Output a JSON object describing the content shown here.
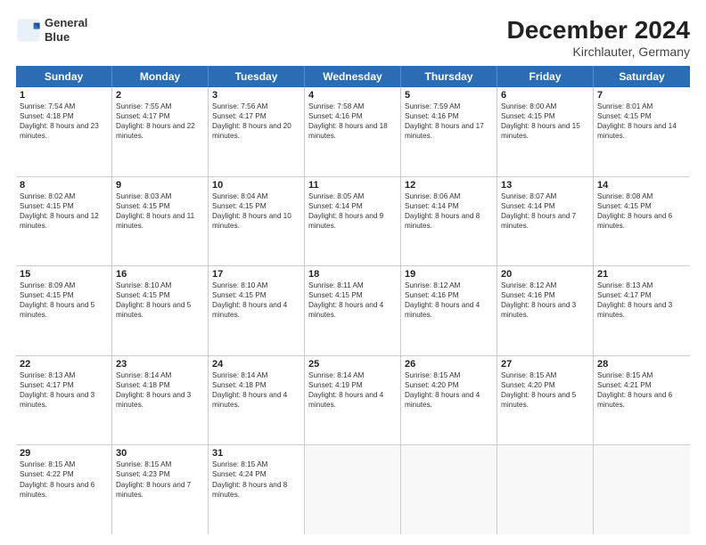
{
  "header": {
    "logo_line1": "General",
    "logo_line2": "Blue",
    "title": "December 2024",
    "subtitle": "Kirchlauter, Germany"
  },
  "days_of_week": [
    "Sunday",
    "Monday",
    "Tuesday",
    "Wednesday",
    "Thursday",
    "Friday",
    "Saturday"
  ],
  "weeks": [
    [
      {
        "day": "1",
        "sunrise": "Sunrise: 7:54 AM",
        "sunset": "Sunset: 4:18 PM",
        "daylight": "Daylight: 8 hours and 23 minutes."
      },
      {
        "day": "2",
        "sunrise": "Sunrise: 7:55 AM",
        "sunset": "Sunset: 4:17 PM",
        "daylight": "Daylight: 8 hours and 22 minutes."
      },
      {
        "day": "3",
        "sunrise": "Sunrise: 7:56 AM",
        "sunset": "Sunset: 4:17 PM",
        "daylight": "Daylight: 8 hours and 20 minutes."
      },
      {
        "day": "4",
        "sunrise": "Sunrise: 7:58 AM",
        "sunset": "Sunset: 4:16 PM",
        "daylight": "Daylight: 8 hours and 18 minutes."
      },
      {
        "day": "5",
        "sunrise": "Sunrise: 7:59 AM",
        "sunset": "Sunset: 4:16 PM",
        "daylight": "Daylight: 8 hours and 17 minutes."
      },
      {
        "day": "6",
        "sunrise": "Sunrise: 8:00 AM",
        "sunset": "Sunset: 4:15 PM",
        "daylight": "Daylight: 8 hours and 15 minutes."
      },
      {
        "day": "7",
        "sunrise": "Sunrise: 8:01 AM",
        "sunset": "Sunset: 4:15 PM",
        "daylight": "Daylight: 8 hours and 14 minutes."
      }
    ],
    [
      {
        "day": "8",
        "sunrise": "Sunrise: 8:02 AM",
        "sunset": "Sunset: 4:15 PM",
        "daylight": "Daylight: 8 hours and 12 minutes."
      },
      {
        "day": "9",
        "sunrise": "Sunrise: 8:03 AM",
        "sunset": "Sunset: 4:15 PM",
        "daylight": "Daylight: 8 hours and 11 minutes."
      },
      {
        "day": "10",
        "sunrise": "Sunrise: 8:04 AM",
        "sunset": "Sunset: 4:15 PM",
        "daylight": "Daylight: 8 hours and 10 minutes."
      },
      {
        "day": "11",
        "sunrise": "Sunrise: 8:05 AM",
        "sunset": "Sunset: 4:14 PM",
        "daylight": "Daylight: 8 hours and 9 minutes."
      },
      {
        "day": "12",
        "sunrise": "Sunrise: 8:06 AM",
        "sunset": "Sunset: 4:14 PM",
        "daylight": "Daylight: 8 hours and 8 minutes."
      },
      {
        "day": "13",
        "sunrise": "Sunrise: 8:07 AM",
        "sunset": "Sunset: 4:14 PM",
        "daylight": "Daylight: 8 hours and 7 minutes."
      },
      {
        "day": "14",
        "sunrise": "Sunrise: 8:08 AM",
        "sunset": "Sunset: 4:15 PM",
        "daylight": "Daylight: 8 hours and 6 minutes."
      }
    ],
    [
      {
        "day": "15",
        "sunrise": "Sunrise: 8:09 AM",
        "sunset": "Sunset: 4:15 PM",
        "daylight": "Daylight: 8 hours and 5 minutes."
      },
      {
        "day": "16",
        "sunrise": "Sunrise: 8:10 AM",
        "sunset": "Sunset: 4:15 PM",
        "daylight": "Daylight: 8 hours and 5 minutes."
      },
      {
        "day": "17",
        "sunrise": "Sunrise: 8:10 AM",
        "sunset": "Sunset: 4:15 PM",
        "daylight": "Daylight: 8 hours and 4 minutes."
      },
      {
        "day": "18",
        "sunrise": "Sunrise: 8:11 AM",
        "sunset": "Sunset: 4:15 PM",
        "daylight": "Daylight: 8 hours and 4 minutes."
      },
      {
        "day": "19",
        "sunrise": "Sunrise: 8:12 AM",
        "sunset": "Sunset: 4:16 PM",
        "daylight": "Daylight: 8 hours and 4 minutes."
      },
      {
        "day": "20",
        "sunrise": "Sunrise: 8:12 AM",
        "sunset": "Sunset: 4:16 PM",
        "daylight": "Daylight: 8 hours and 3 minutes."
      },
      {
        "day": "21",
        "sunrise": "Sunrise: 8:13 AM",
        "sunset": "Sunset: 4:17 PM",
        "daylight": "Daylight: 8 hours and 3 minutes."
      }
    ],
    [
      {
        "day": "22",
        "sunrise": "Sunrise: 8:13 AM",
        "sunset": "Sunset: 4:17 PM",
        "daylight": "Daylight: 8 hours and 3 minutes."
      },
      {
        "day": "23",
        "sunrise": "Sunrise: 8:14 AM",
        "sunset": "Sunset: 4:18 PM",
        "daylight": "Daylight: 8 hours and 3 minutes."
      },
      {
        "day": "24",
        "sunrise": "Sunrise: 8:14 AM",
        "sunset": "Sunset: 4:18 PM",
        "daylight": "Daylight: 8 hours and 4 minutes."
      },
      {
        "day": "25",
        "sunrise": "Sunrise: 8:14 AM",
        "sunset": "Sunset: 4:19 PM",
        "daylight": "Daylight: 8 hours and 4 minutes."
      },
      {
        "day": "26",
        "sunrise": "Sunrise: 8:15 AM",
        "sunset": "Sunset: 4:20 PM",
        "daylight": "Daylight: 8 hours and 4 minutes."
      },
      {
        "day": "27",
        "sunrise": "Sunrise: 8:15 AM",
        "sunset": "Sunset: 4:20 PM",
        "daylight": "Daylight: 8 hours and 5 minutes."
      },
      {
        "day": "28",
        "sunrise": "Sunrise: 8:15 AM",
        "sunset": "Sunset: 4:21 PM",
        "daylight": "Daylight: 8 hours and 6 minutes."
      }
    ],
    [
      {
        "day": "29",
        "sunrise": "Sunrise: 8:15 AM",
        "sunset": "Sunset: 4:22 PM",
        "daylight": "Daylight: 8 hours and 6 minutes."
      },
      {
        "day": "30",
        "sunrise": "Sunrise: 8:15 AM",
        "sunset": "Sunset: 4:23 PM",
        "daylight": "Daylight: 8 hours and 7 minutes."
      },
      {
        "day": "31",
        "sunrise": "Sunrise: 8:15 AM",
        "sunset": "Sunset: 4:24 PM",
        "daylight": "Daylight: 8 hours and 8 minutes."
      },
      null,
      null,
      null,
      null
    ]
  ]
}
